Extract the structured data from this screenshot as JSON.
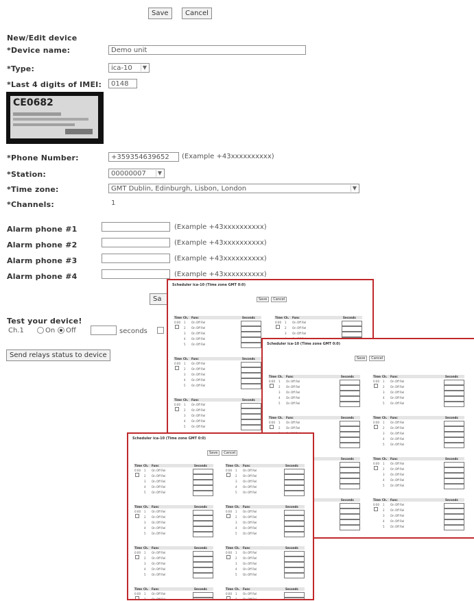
{
  "top_buttons": {
    "save": "Save",
    "cancel": "Cancel"
  },
  "form": {
    "section_title": "New/Edit device",
    "device_name": {
      "label": "*Device name:",
      "value": "Demo unit"
    },
    "type": {
      "label": "*Type:",
      "value": "ica-10"
    },
    "imei": {
      "label": "*Last 4 digits of IMEI:",
      "value": "0148"
    },
    "imei_sticker_text": "CE0682",
    "phone": {
      "label": "*Phone Number:",
      "value": "+359354639652",
      "hint": "(Example +43xxxxxxxxxx)"
    },
    "station": {
      "label": "*Station:",
      "value": "00000007"
    },
    "timezone": {
      "label": "*Time zone:",
      "value": "GMT Dublin, Edinburgh, Lisbon, London"
    },
    "channels": {
      "label": "*Channels:",
      "value": "1"
    },
    "alarms": [
      {
        "label": "Alarm phone #1",
        "hint": "(Example +43xxxxxxxxxx)"
      },
      {
        "label": "Alarm phone #2",
        "hint": "(Example +43xxxxxxxxxx)"
      },
      {
        "label": "Alarm phone #3",
        "hint": "(Example +43xxxxxxxxxx)"
      },
      {
        "label": "Alarm phone #4",
        "hint": "(Example +43xxxxxxxxxx)"
      }
    ],
    "bottom_save_partial": "Sa",
    "test_title": "Test your device!",
    "test_channel": "Ch.1",
    "test_on": "On",
    "test_off": "Off",
    "test_seconds": "seconds",
    "send_relays": "Send relays status to device"
  },
  "scheduler": {
    "title": "Scheduler ica-10 (Time zone GMT 0:0)",
    "save": "Save",
    "cancel": "Cancel",
    "col_time": "Time",
    "col_ch": "Ch.",
    "col_func": "Func",
    "col_seconds": "Seconds",
    "func_options": "On Off Rel",
    "time_value": "0:00"
  },
  "colors": {
    "highlight_border": "#c0282a"
  }
}
